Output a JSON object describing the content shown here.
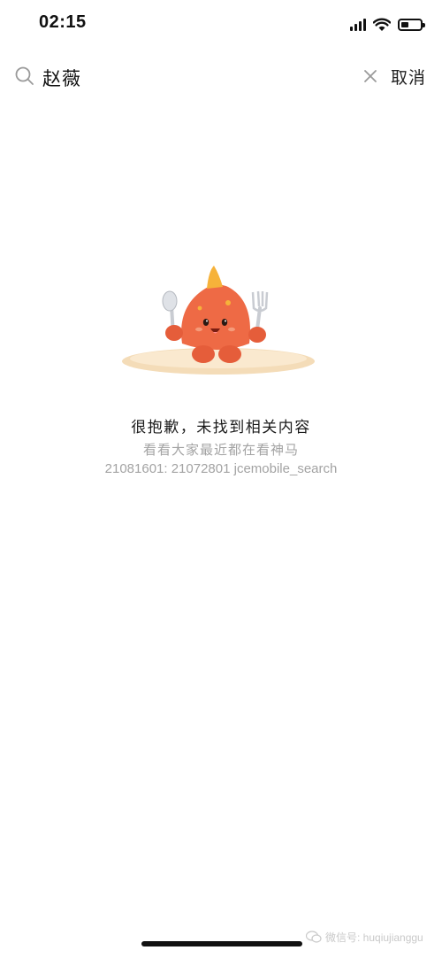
{
  "status_bar": {
    "time": "02:15",
    "icons": [
      "signal-icon",
      "wifi-icon",
      "battery-icon"
    ],
    "battery_level": 0.4
  },
  "search": {
    "query": "赵薇",
    "cancel_label": "取消",
    "icons": [
      "search-icon",
      "clear-icon"
    ]
  },
  "empty_state": {
    "illustration": "orange-mascot-with-spoon-and-fork",
    "title": "很抱歉，未找到相关内容",
    "hint": "看看大家最近都在看神马",
    "code": "21081601: 21072801 jcemobile_search"
  },
  "watermark": {
    "text": "微信号: huqiujianggu"
  },
  "colors": {
    "background": "#ffffff",
    "text_primary": "#1a1a1a",
    "text_secondary": "#a3a3a3",
    "mascot": "#ee6a45"
  }
}
